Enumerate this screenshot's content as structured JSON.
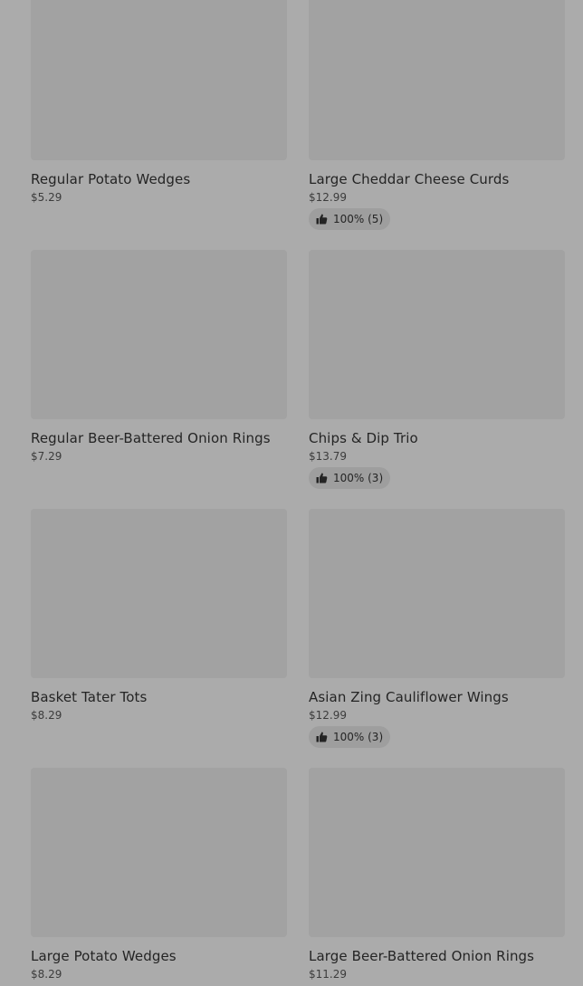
{
  "items": [
    {
      "name": "Regular Potato Wedges",
      "price": "$5.29"
    },
    {
      "name": "Large Cheddar Cheese Curds",
      "price": "$12.99",
      "rating": "100% (5)"
    },
    {
      "name": "Regular Beer-Battered Onion Rings",
      "price": "$7.29"
    },
    {
      "name": "Chips & Dip Trio",
      "price": "$13.79",
      "rating": "100% (3)"
    },
    {
      "name": "Basket Tater Tots",
      "price": "$8.29"
    },
    {
      "name": "Asian Zing Cauliflower Wings",
      "price": "$12.99",
      "rating": "100% (3)"
    },
    {
      "name": "Large Potato Wedges",
      "price": "$8.29"
    },
    {
      "name": "Large Beer-Battered Onion Rings",
      "price": "$11.29"
    }
  ],
  "icons": {
    "rating": "thumbs-up-icon"
  },
  "colors": {
    "background": "#ababab",
    "thumbnail": "#a2a2a2",
    "text": "#242424",
    "rating_pill": "#9e9e9e"
  }
}
